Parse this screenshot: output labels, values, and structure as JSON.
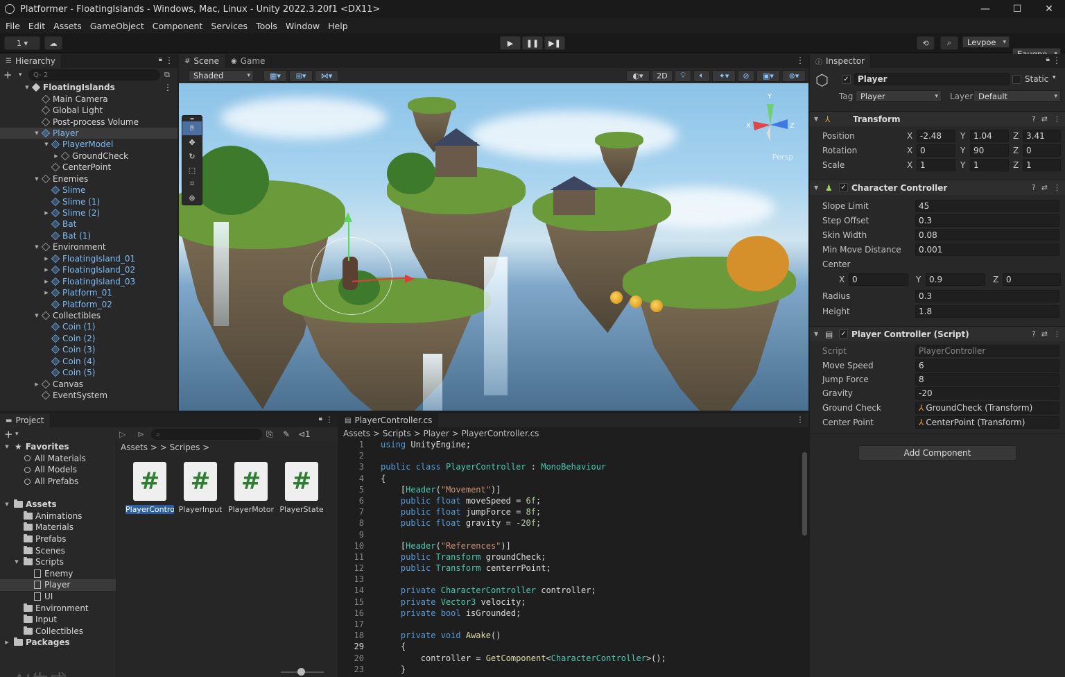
{
  "window": {
    "title": "Platformer - FloatingIslands - Windows, Mac, Linux - Unity 2022.3.20f1 <DX11>",
    "controls": [
      "—",
      "☐",
      "✕"
    ]
  },
  "menu": [
    "File",
    "Edit",
    "Assets",
    "GameObject",
    "Component",
    "Services",
    "Tools",
    "Window",
    "Help"
  ],
  "toolbar": {
    "account_label": "1 ▾",
    "layers_label": "Levpoe",
    "layout_label": "Eaugne",
    "play_icons": [
      "▶",
      "❚❚",
      "▶❚"
    ]
  },
  "hierarchy": {
    "tab": "Hierarchy",
    "search_placeholder": "Q- 2",
    "items": [
      {
        "label": "FloatingIslands",
        "depth": 0,
        "arrow": "▼",
        "kind": "scene"
      },
      {
        "label": "Main Camera",
        "depth": 1,
        "arrow": "",
        "kind": "object"
      },
      {
        "label": "Global Light",
        "depth": 1,
        "arrow": "",
        "kind": "object"
      },
      {
        "label": "Post-process Volume",
        "depth": 1,
        "arrow": "",
        "kind": "object"
      },
      {
        "label": "Player",
        "depth": 1,
        "arrow": "▼",
        "kind": "prefab",
        "selected": true
      },
      {
        "label": "PlayerModel",
        "depth": 2,
        "arrow": "▼",
        "kind": "prefab"
      },
      {
        "label": "GroundCheck",
        "depth": 3,
        "arrow": "▶",
        "kind": "object"
      },
      {
        "label": "CenterPoint",
        "depth": 2,
        "arrow": "",
        "kind": "object"
      },
      {
        "label": "Enemies",
        "depth": 1,
        "arrow": "▼",
        "kind": "object"
      },
      {
        "label": "Slime",
        "depth": 2,
        "arrow": "",
        "kind": "prefab"
      },
      {
        "label": "Slime (1)",
        "depth": 2,
        "arrow": "",
        "kind": "prefab"
      },
      {
        "label": "Slime (2)",
        "depth": 2,
        "arrow": "▶",
        "kind": "prefab"
      },
      {
        "label": "Bat",
        "depth": 2,
        "arrow": "",
        "kind": "prefab"
      },
      {
        "label": "Bat (1)",
        "depth": 2,
        "arrow": "",
        "kind": "prefab"
      },
      {
        "label": "Environment",
        "depth": 1,
        "arrow": "▼",
        "kind": "object"
      },
      {
        "label": "FloatingIsland_01",
        "depth": 2,
        "arrow": "▶",
        "kind": "prefab"
      },
      {
        "label": "FloatingIsland_02",
        "depth": 2,
        "arrow": "▶",
        "kind": "prefab"
      },
      {
        "label": "FloatingIsland_03",
        "depth": 2,
        "arrow": "▶",
        "kind": "prefab"
      },
      {
        "label": "Platform_01",
        "depth": 2,
        "arrow": "▶",
        "kind": "prefab"
      },
      {
        "label": "Platform_02",
        "depth": 2,
        "arrow": "",
        "kind": "prefab"
      },
      {
        "label": "Collectibles",
        "depth": 1,
        "arrow": "▼",
        "kind": "object"
      },
      {
        "label": "Coin (1)",
        "depth": 2,
        "arrow": "",
        "kind": "prefab"
      },
      {
        "label": "Coin (2)",
        "depth": 2,
        "arrow": "",
        "kind": "prefab"
      },
      {
        "label": "Coin (3)",
        "depth": 2,
        "arrow": "",
        "kind": "prefab"
      },
      {
        "label": "Coin (4)",
        "depth": 2,
        "arrow": "",
        "kind": "prefab"
      },
      {
        "label": "Coin (5)",
        "depth": 2,
        "arrow": "",
        "kind": "prefab"
      },
      {
        "label": "Canvas",
        "depth": 1,
        "arrow": "▶",
        "kind": "object"
      },
      {
        "label": "EventSystem",
        "depth": 1,
        "arrow": "",
        "kind": "object"
      }
    ]
  },
  "scene": {
    "tabs": [
      "Scene",
      "Game"
    ],
    "shading_mode": "Shaded",
    "mode_2d_label": "2D",
    "persp_label": "Persp",
    "axis_labels": {
      "x": "X",
      "y": "Y",
      "z": "Z"
    }
  },
  "inspector": {
    "tab": "Inspector",
    "object_name": "Player",
    "static_label": "Static",
    "tag_label": "Tag",
    "tag_value": "Player",
    "layer_label": "Layer",
    "layer_value": "Default",
    "transform": {
      "title": "Transform",
      "rows": [
        {
          "label": "Position",
          "x": "-2.48",
          "y": "1.04",
          "z": "3.41"
        },
        {
          "label": "Rotation",
          "x": "0",
          "y": "90",
          "z": "0"
        },
        {
          "label": "Scale",
          "x": "1",
          "y": "1",
          "z": "1"
        }
      ]
    },
    "character_controller": {
      "title": "Character Controller",
      "slope_limit_label": "Slope Limit",
      "slope_limit": "45",
      "step_offset_label": "Step Offset",
      "step_offset": "0.3",
      "skin_width_label": "Skin Width",
      "skin_width": "0.08",
      "min_move_label": "Min Move Distance",
      "min_move": "0.001",
      "center_label": "Center",
      "center": {
        "x": "0",
        "y": "0.9",
        "z": "0"
      },
      "radius_label": "Radius",
      "radius": "0.3",
      "height_label": "Height",
      "height": "1.8"
    },
    "player_controller": {
      "title": "Player Controller (Script)",
      "script_label": "Script",
      "script_value": "PlayerController",
      "move_speed_label": "Move Speed",
      "move_speed": "6",
      "jump_force_label": "Jump Force",
      "jump_force": "8",
      "gravity_label": "Gravity",
      "gravity": "-20",
      "ground_check_label": "Ground Check",
      "ground_check": "GroundCheck (Transform)",
      "center_point_label": "Center Point",
      "center_point": "CenterPoint (Transform)"
    },
    "add_component_label": "Add Component",
    "axis": {
      "x": "X",
      "y": "Y",
      "z": "Z"
    }
  },
  "project": {
    "tab": "Project",
    "breadcrumb": "Assets > > Scripes >",
    "tree": [
      {
        "label": "Favorites",
        "depth": 0,
        "arrow": "▼",
        "kind": "star",
        "bold": true
      },
      {
        "label": "All Materials",
        "depth": 1,
        "arrow": "",
        "kind": "search"
      },
      {
        "label": "All Models",
        "depth": 1,
        "arrow": "",
        "kind": "search"
      },
      {
        "label": "All Prefabs",
        "depth": 1,
        "arrow": "",
        "kind": "search"
      },
      {
        "label": "",
        "depth": 0,
        "arrow": "",
        "kind": "spacer"
      },
      {
        "label": "Assets",
        "depth": 0,
        "arrow": "▼",
        "kind": "folder",
        "bold": true
      },
      {
        "label": "Animations",
        "depth": 1,
        "arrow": "",
        "kind": "folder"
      },
      {
        "label": "Materials",
        "depth": 1,
        "arrow": "",
        "kind": "folder"
      },
      {
        "label": "Prefabs",
        "depth": 1,
        "arrow": "",
        "kind": "folder"
      },
      {
        "label": "Scenes",
        "depth": 1,
        "arrow": "",
        "kind": "folder"
      },
      {
        "label": "Scripts",
        "depth": 1,
        "arrow": "▼",
        "kind": "folder"
      },
      {
        "label": "Enemy",
        "depth": 2,
        "arrow": "",
        "kind": "script"
      },
      {
        "label": "Player",
        "depth": 2,
        "arrow": "",
        "kind": "script",
        "selected": true
      },
      {
        "label": "UI",
        "depth": 2,
        "arrow": "",
        "kind": "script"
      },
      {
        "label": "Environment",
        "depth": 1,
        "arrow": "",
        "kind": "folder"
      },
      {
        "label": "Input",
        "depth": 1,
        "arrow": "",
        "kind": "folder"
      },
      {
        "label": "Collectibles",
        "depth": 1,
        "arrow": "",
        "kind": "folder"
      },
      {
        "label": "Packages",
        "depth": 0,
        "arrow": "▶",
        "kind": "folder",
        "bold": true
      }
    ],
    "assets": [
      {
        "name": "PlayerControll",
        "glyph": "#",
        "selected": true
      },
      {
        "name": "PlayerInput",
        "glyph": "#"
      },
      {
        "name": "PlayerMotor",
        "glyph": "#"
      },
      {
        "name": "PlayerState",
        "glyph": "#"
      }
    ],
    "watermark": "AI生成"
  },
  "editor": {
    "tab": "PlayerController.cs",
    "breadcrumb": "Assets  >  Scripts  >  Player  >  PlayerController.cs",
    "lines": [
      {
        "n": "1",
        "html": "<span class=\"kw\">using</span> UnityEngine;"
      },
      {
        "n": "2",
        "html": ""
      },
      {
        "n": "3",
        "html": "<span class=\"kw\">public class</span> <span class=\"ty\">PlayerController</span> : <span class=\"ty\">MonoBehaviour</span>"
      },
      {
        "n": "4",
        "html": "{"
      },
      {
        "n": "5",
        "html": "    [<span class=\"ty\">Header</span>(<span class=\"str\">\"Movement\"</span>)]"
      },
      {
        "n": "6",
        "html": "    <span class=\"kw\">public float</span> moveSpeed = <span class=\"num\">6f</span>;"
      },
      {
        "n": "7",
        "html": "    <span class=\"kw\">public float</span> jumpForce = <span class=\"num\">8f</span>;"
      },
      {
        "n": "8",
        "html": "    <span class=\"kw\">public float</span> gravity = <span class=\"num\">-20f</span>;"
      },
      {
        "n": "9",
        "html": ""
      },
      {
        "n": "10",
        "html": "    [<span class=\"ty\">Header</span>(<span class=\"str\">\"References\"</span>)]"
      },
      {
        "n": "11",
        "html": "    <span class=\"kw\">public</span> <span class=\"ty\">Transform</span> groundCheck;"
      },
      {
        "n": "12",
        "html": "    <span class=\"kw\">public</span> <span class=\"ty\">Transform</span> centerrPoint;"
      },
      {
        "n": "13",
        "html": ""
      },
      {
        "n": "14",
        "html": "    <span class=\"kw\">private</span> <span class=\"ty\">CharacterController</span> controller;"
      },
      {
        "n": "15",
        "html": "    <span class=\"kw\">private</span> <span class=\"ty\">Vector3</span> velocity;"
      },
      {
        "n": "16",
        "html": "    <span class=\"kw\">private bool</span> isGrounded;"
      },
      {
        "n": "17",
        "html": ""
      },
      {
        "n": "18",
        "html": "    <span class=\"kw\">private void</span> <span class=\"fn\">Awake</span>()"
      },
      {
        "n": "29",
        "html": "    {",
        "current": true
      },
      {
        "n": "20",
        "html": "        controller = <span class=\"fn\">GetComponent</span>&lt;<span class=\"ty\">CharacterController</span>&gt;();"
      },
      {
        "n": "23",
        "html": "    }"
      }
    ]
  },
  "colors": {
    "accent": "#2c5d9c",
    "prefab": "#7dbbf5",
    "bg": "#282828"
  }
}
